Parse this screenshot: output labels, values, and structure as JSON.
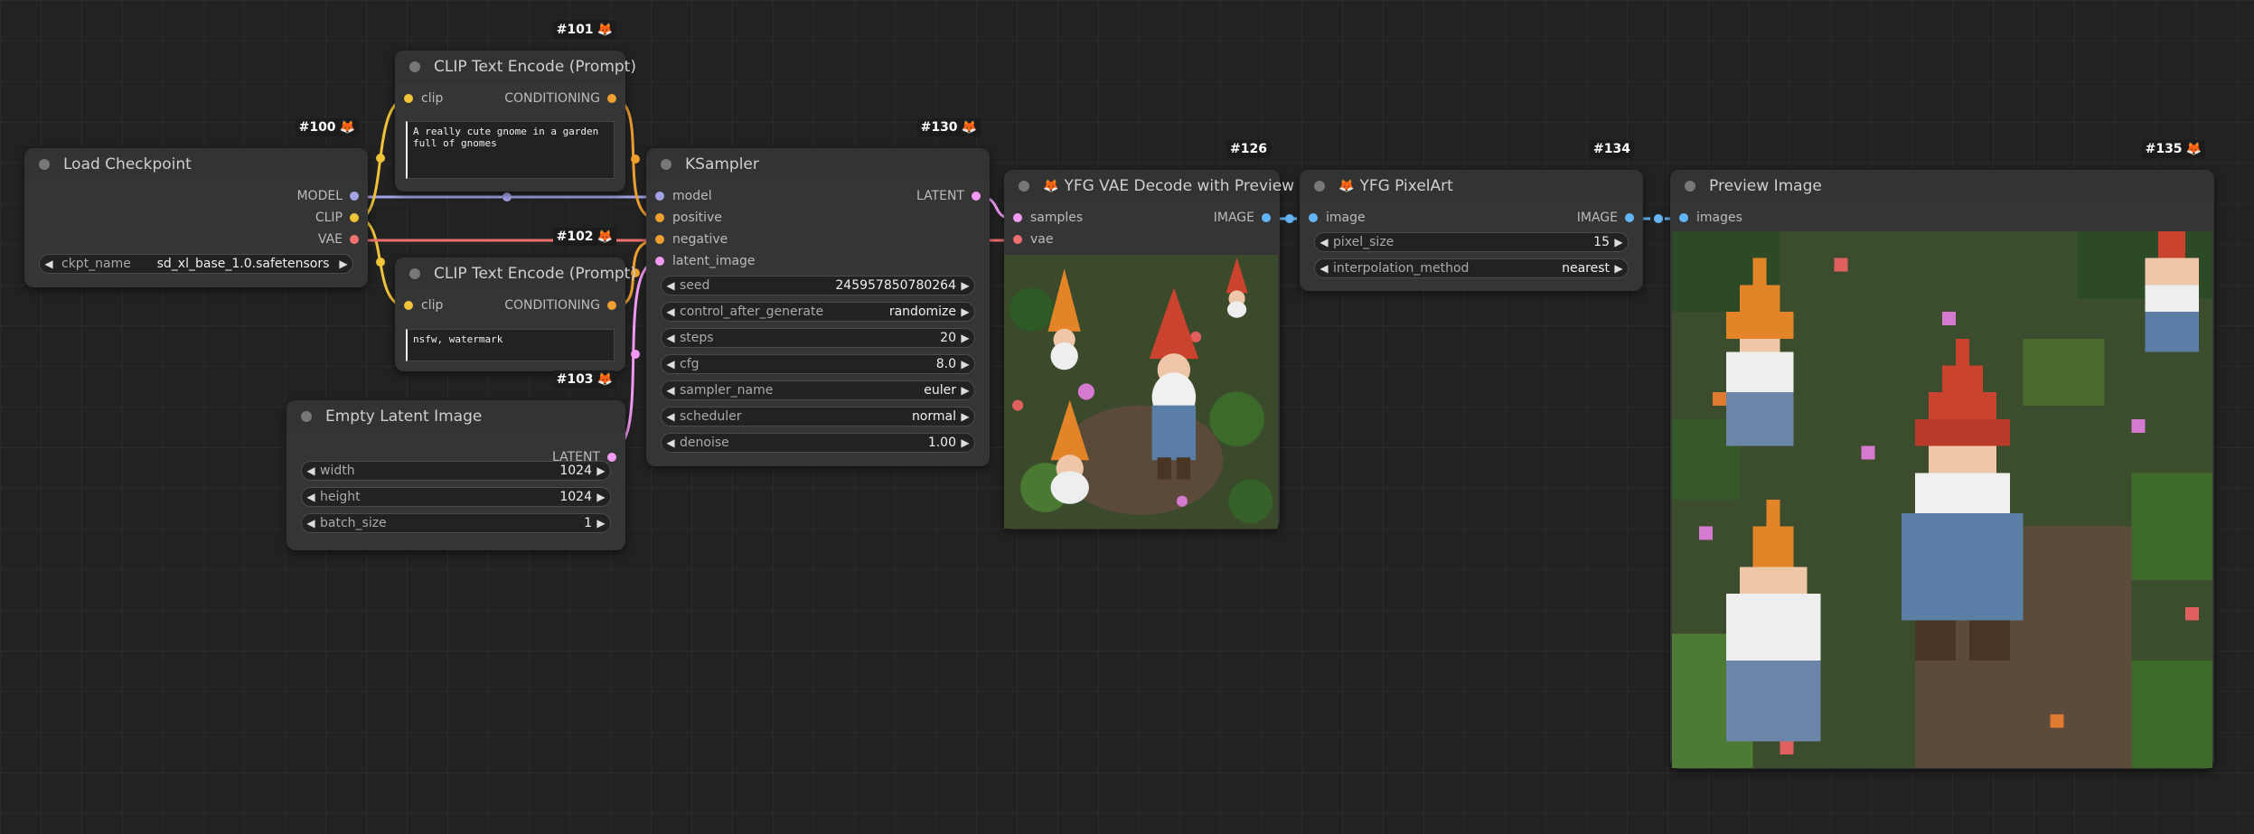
{
  "colors": {
    "model": "#a3a3e6",
    "clip": "#f2c43a",
    "vae": "#f07070",
    "conditioning": "#f0a030",
    "latent": "#f39af5",
    "image": "#64b5f6"
  },
  "nodes": {
    "load_checkpoint": {
      "id": "#100",
      "title": "Load Checkpoint",
      "outputs": [
        "MODEL",
        "CLIP",
        "VAE"
      ],
      "widget": {
        "name": "ckpt_name",
        "value": "sd_xl_base_1.0.safetensors"
      }
    },
    "clip_pos": {
      "id": "#101",
      "title": "CLIP Text Encode (Prompt)",
      "input": "clip",
      "output": "CONDITIONING",
      "text": "A really cute gnome in a garden full of gnomes"
    },
    "clip_neg": {
      "id": "#102",
      "title": "CLIP Text Encode (Prompt)",
      "input": "clip",
      "output": "CONDITIONING",
      "text": "nsfw, watermark"
    },
    "empty_latent": {
      "id": "#103",
      "title": "Empty Latent Image",
      "output": "LATENT",
      "widgets": [
        {
          "name": "width",
          "value": "1024"
        },
        {
          "name": "height",
          "value": "1024"
        },
        {
          "name": "batch_size",
          "value": "1"
        }
      ]
    },
    "ksampler": {
      "id": "#130",
      "title": "KSampler",
      "inputs": [
        "model",
        "positive",
        "negative",
        "latent_image"
      ],
      "output": "LATENT",
      "widgets": [
        {
          "name": "seed",
          "value": "245957850780264"
        },
        {
          "name": "control_after_generate",
          "value": "randomize"
        },
        {
          "name": "steps",
          "value": "20"
        },
        {
          "name": "cfg",
          "value": "8.0"
        },
        {
          "name": "sampler_name",
          "value": "euler"
        },
        {
          "name": "scheduler",
          "value": "normal"
        },
        {
          "name": "denoise",
          "value": "1.00"
        }
      ]
    },
    "vae_decode": {
      "id": "#126",
      "title": "YFG VAE Decode with Preview",
      "inputs": [
        "samples",
        "vae"
      ],
      "output": "IMAGE"
    },
    "pixelart": {
      "id": "#134",
      "title": "YFG PixelArt",
      "input": "image",
      "output": "IMAGE",
      "widgets": [
        {
          "name": "pixel_size",
          "value": "15"
        },
        {
          "name": "interpolation_method",
          "value": "nearest"
        }
      ]
    },
    "preview": {
      "id": "#135",
      "title": "Preview Image",
      "input": "images"
    }
  }
}
